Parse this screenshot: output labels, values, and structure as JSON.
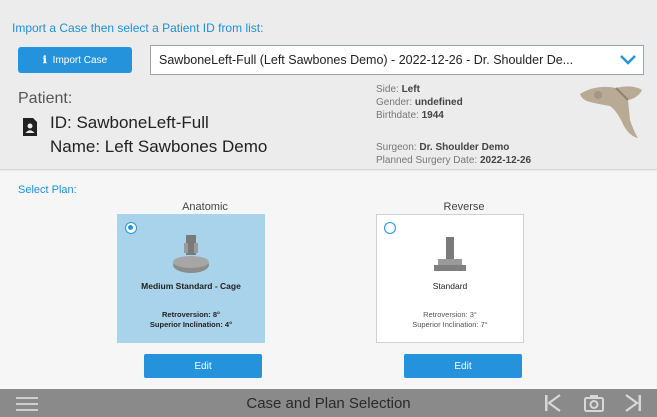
{
  "header": {
    "instruction": "Import a Case then select a Patient ID from list:",
    "import_button": "Import Case",
    "import_icon": "info-icon",
    "case_select_value": "SawboneLeft-Full (Left Sawbones Demo) - 2022-12-26 - Dr. Shoulder De..."
  },
  "patient": {
    "label": "Patient:",
    "id_line": "ID: SawboneLeft-Full",
    "name_line": "Name: Left Sawbones Demo",
    "details": {
      "side_label": "Side:",
      "side_value": "Left",
      "gender_label": "Gender:",
      "gender_value": "undefined",
      "birthdate_label": "Birthdate:",
      "birthdate_value": "1944",
      "surgeon_label": "Surgeon:",
      "surgeon_value": "Dr. Shoulder Demo",
      "surgery_date_label": "Planned Surgery Date:",
      "surgery_date_value": "2022-12-26"
    }
  },
  "plans": {
    "heading": "Select Plan:",
    "anatomic": {
      "title": "Anatomic",
      "name": "Medium Standard - Cage",
      "retroversion": "Retroversion: 8°",
      "inclination": "Superior Inclination: 4°",
      "edit": "Edit"
    },
    "reverse": {
      "title": "Reverse",
      "name": "Standard",
      "retroversion": "Retroversion: 3°",
      "inclination": "Superior Inclination: 7°",
      "edit": "Edit"
    }
  },
  "footer": {
    "title": "Case and Plan Selection"
  },
  "colors": {
    "accent": "#2493db",
    "selected_card": "#a9d3ea",
    "bottom_bar": "#8a8a8a"
  }
}
